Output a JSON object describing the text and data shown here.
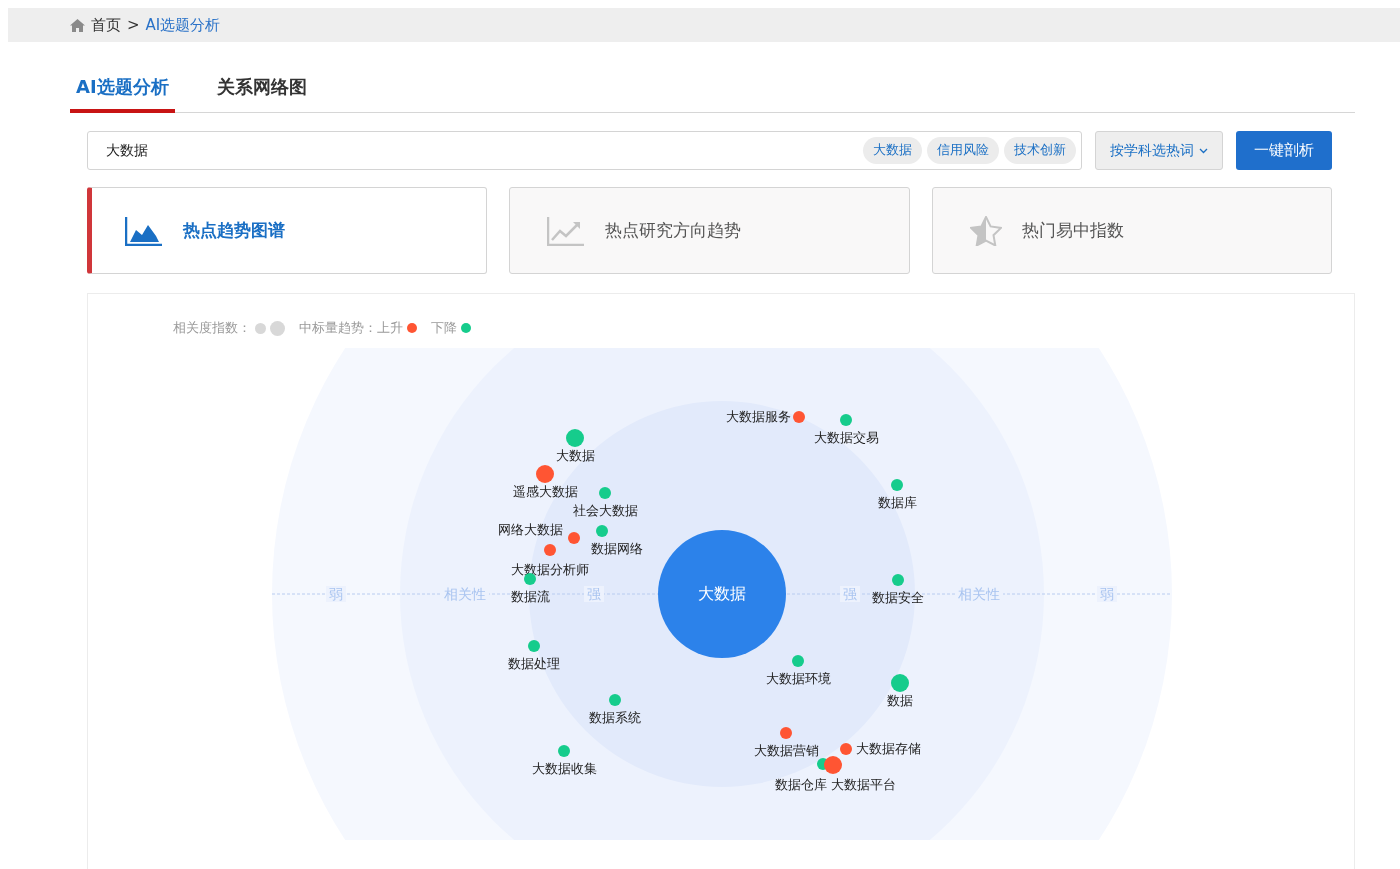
{
  "breadcrumb": {
    "home": "首页",
    "separator": ">",
    "current": "AI选题分析"
  },
  "tabs": [
    {
      "label": "AI选题分析",
      "selected": true
    },
    {
      "label": "关系网络图",
      "selected": false
    }
  ],
  "search": {
    "value": "大数据",
    "tags": [
      "大数据",
      "信用风险",
      "技术创新"
    ],
    "subject_button": "按学科选热词",
    "analyze_button": "一键剖析"
  },
  "cards": [
    {
      "kind": "area",
      "label": "热点趋势图谱",
      "selected": true
    },
    {
      "kind": "trend",
      "label": "热点研究方向趋势",
      "selected": false
    },
    {
      "kind": "star",
      "label": "热门易中指数",
      "selected": false
    }
  ],
  "legend": {
    "relevance_label": "相关度指数：",
    "trend_label": "中标量趋势：上升",
    "down_label": "下降"
  },
  "chart": {
    "center": "大数据",
    "axis_labels": [
      "弱",
      "相关性",
      "强",
      "强",
      "相关性",
      "弱"
    ],
    "nodes": [
      {
        "label": "大数据",
        "color": "#16cc8c",
        "large": true
      },
      {
        "label": "遥感大数据",
        "color": "#ff5533",
        "large": true
      },
      {
        "label": "社会大数据",
        "color": "#16cc8c",
        "large": false
      },
      {
        "label": "数据网络",
        "color": "#16cc8c",
        "large": false
      },
      {
        "label": "网络大数据",
        "color": "#ff5533",
        "large": false
      },
      {
        "label": "大数据分析师",
        "color": "#ff5533",
        "large": false
      },
      {
        "label": "数据流",
        "color": "#16cc8c",
        "large": false
      },
      {
        "label": "数据处理",
        "color": "#16cc8c",
        "large": false
      },
      {
        "label": "数据系统",
        "color": "#16cc8c",
        "large": false
      },
      {
        "label": "大数据收集",
        "color": "#16cc8c",
        "large": false
      },
      {
        "label": "大数据服务",
        "color": "#ff5533",
        "large": false
      },
      {
        "label": "大数据交易",
        "color": "#16cc8c",
        "large": false
      },
      {
        "label": "数据库",
        "color": "#16cc8c",
        "large": false
      },
      {
        "label": "数据安全",
        "color": "#16cc8c",
        "large": false
      },
      {
        "label": "大数据环境",
        "color": "#16cc8c",
        "large": false
      },
      {
        "label": "数据",
        "color": "#16cc8c",
        "large": true
      },
      {
        "label": "大数据营销",
        "color": "#ff5533",
        "large": false
      },
      {
        "label": "大数据存储",
        "color": "#ff5533",
        "large": false
      },
      {
        "label": "数据仓库",
        "color": "#16cc8c",
        "large": false
      },
      {
        "label": "大数据平台",
        "color": "#ff5533",
        "large": true
      }
    ]
  }
}
